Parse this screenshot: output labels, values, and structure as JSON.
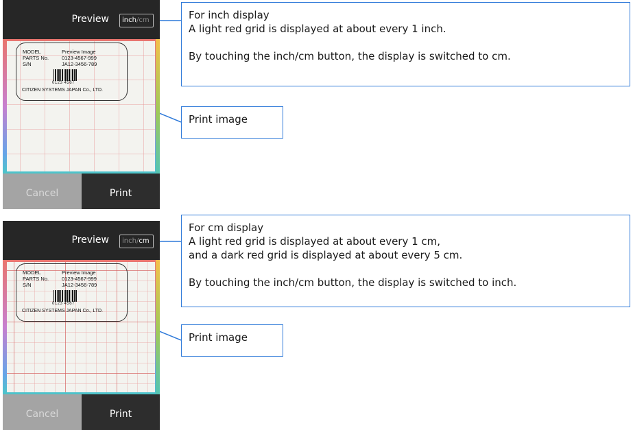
{
  "panels": [
    {
      "header": {
        "title": "Preview",
        "unit_active": "inch",
        "unit_separator": "/",
        "unit_inactive": "cm"
      },
      "label": {
        "model_key": "MODEL",
        "model_value": "Preview Image",
        "parts_key": "PARTS No.",
        "parts_value": "0123-4567-999",
        "sn_key": "S/N",
        "sn_value": "JA12-3456-789",
        "barcode_digits": "0123 4567",
        "company": "CITIZEN SYSTEMS JAPAN Co., LTD."
      },
      "buttons": {
        "cancel": "Cancel",
        "print": "Print"
      },
      "callout_main": {
        "title": "For inch display",
        "line1": "A light red grid is displayed at about every 1 inch.",
        "line2": "By touching the inch/cm button, the display is switched to cm."
      },
      "callout_image": "Print image"
    },
    {
      "header": {
        "title": "Preview",
        "unit_inactive": "inch",
        "unit_separator": "/",
        "unit_active": "cm"
      },
      "label": {
        "model_key": "MODEL",
        "model_value": "Preview Image",
        "parts_key": "PARTS No.",
        "parts_value": "0123-4567-999",
        "sn_key": "S/N",
        "sn_value": "JA12-3456-789",
        "barcode_digits": "0123 4567",
        "company": "CITIZEN SYSTEMS JAPAN Co., LTD."
      },
      "buttons": {
        "cancel": "Cancel",
        "print": "Print"
      },
      "callout_main": {
        "title": "For cm display",
        "line1": "A light red grid is displayed at about every 1 cm,",
        "line2": "and a dark red grid is displayed at about every 5 cm.",
        "line3": "By touching the inch/cm button, the display is switched to inch."
      },
      "callout_image": "Print image"
    }
  ],
  "colors": {
    "callout_border": "#2f7ad9",
    "header_bg": "#262626",
    "cancel_bg": "#a4a4a4",
    "print_bg": "#2d2d2d"
  }
}
